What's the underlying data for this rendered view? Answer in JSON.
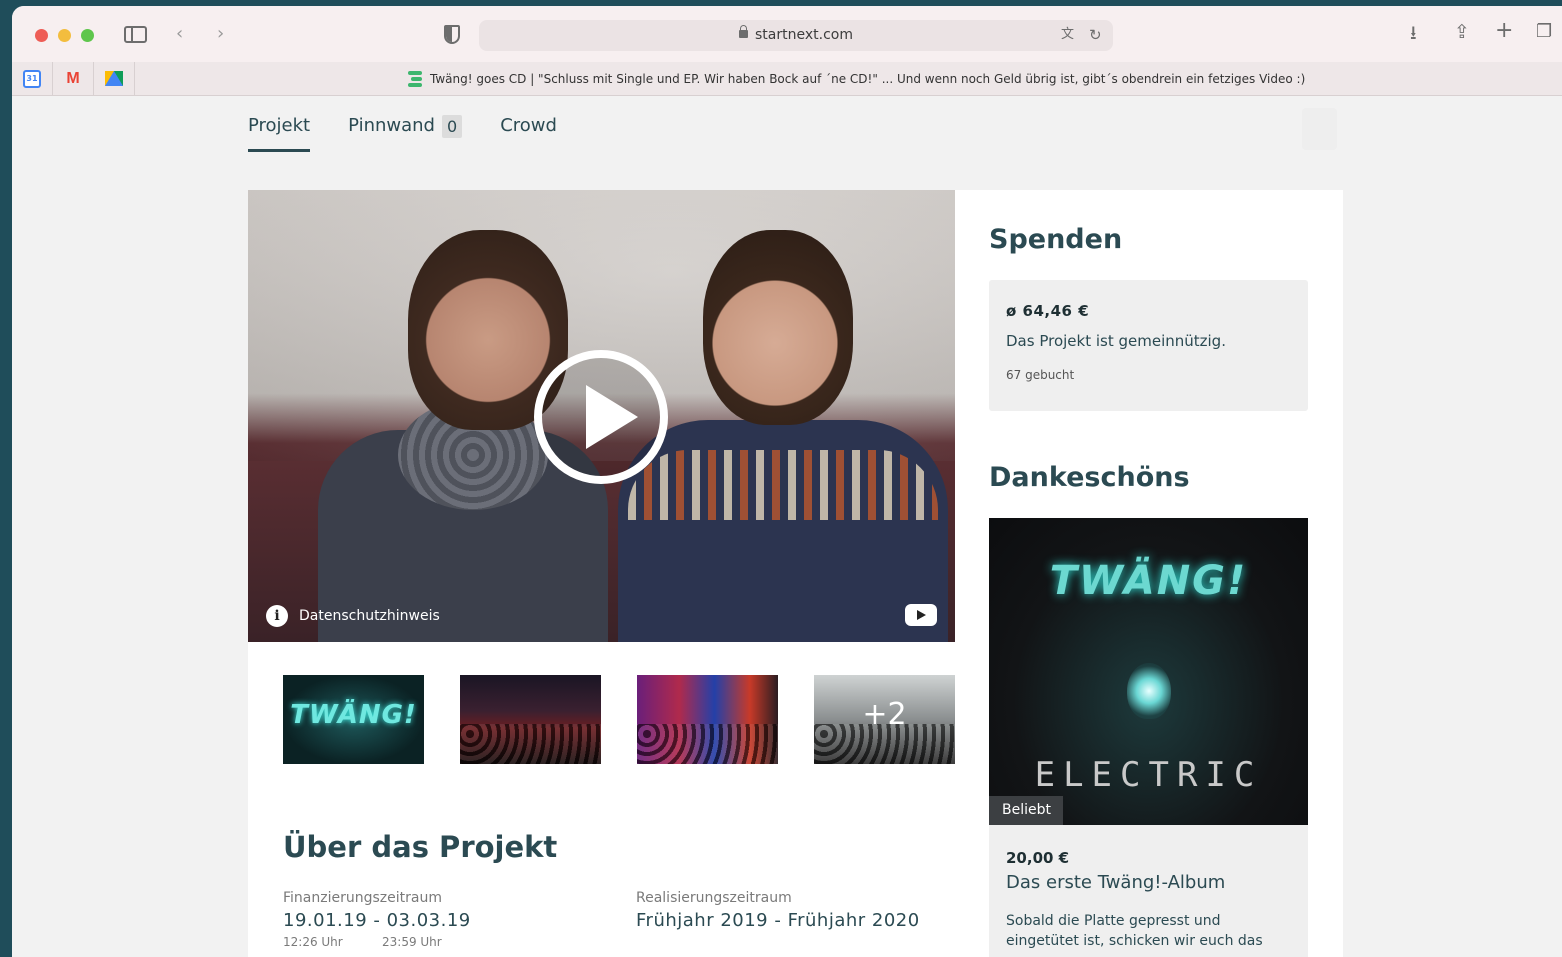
{
  "browser": {
    "url": "startnext.com",
    "tab_title": "Twäng! goes CD | \"Schluss mit Single und EP. Wir haben Bock auf ´ne CD!\" ... Und wenn noch Geld übrig ist, gibt´s obendrein ein fetziges Video :)",
    "pinned_tabs": [
      {
        "name": "Google Calendar",
        "icon": "calendar-icon",
        "label": "31"
      },
      {
        "name": "Gmail",
        "icon": "gmail-icon",
        "label": "M"
      },
      {
        "name": "Google Drive",
        "icon": "drive-icon"
      }
    ]
  },
  "nav": {
    "tabs": [
      {
        "label": "Projekt",
        "active": true
      },
      {
        "label": "Pinnwand",
        "badge": "0"
      },
      {
        "label": "Crowd"
      }
    ]
  },
  "video": {
    "privacy_label": "Datenschutzhinweis",
    "info_glyph": "i"
  },
  "gallery": {
    "thumb1_logo": "TWÄNG!",
    "more_label": "+2"
  },
  "about": {
    "title": "Über das Projekt",
    "funding": {
      "label": "Finanzierungszeitraum",
      "value": "19.01.19 - 03.03.19",
      "start_time": "12:26 Uhr",
      "end_time": "23:59 Uhr"
    },
    "realization": {
      "label": "Realisierungszeitraum",
      "value": "Frühjahr 2019 - Frühjahr 2020"
    }
  },
  "donate": {
    "title": "Spenden",
    "average": "ø 64,46 €",
    "note": "Das Projekt ist gemeinnützig.",
    "booked": "67 gebucht"
  },
  "rewards": {
    "title": "Dankeschöns",
    "item": {
      "logo": "TWÄNG!",
      "image_word": "ELECTRIC",
      "badge": "Beliebt",
      "price": "20,00 €",
      "name": "Das erste Twäng!-Album",
      "description": "Sobald die Platte gepresst und eingetütet ist, schicken wir euch das"
    }
  },
  "colors": {
    "brand_dark": "#2b4a52",
    "accent_green": "#3db66e"
  }
}
